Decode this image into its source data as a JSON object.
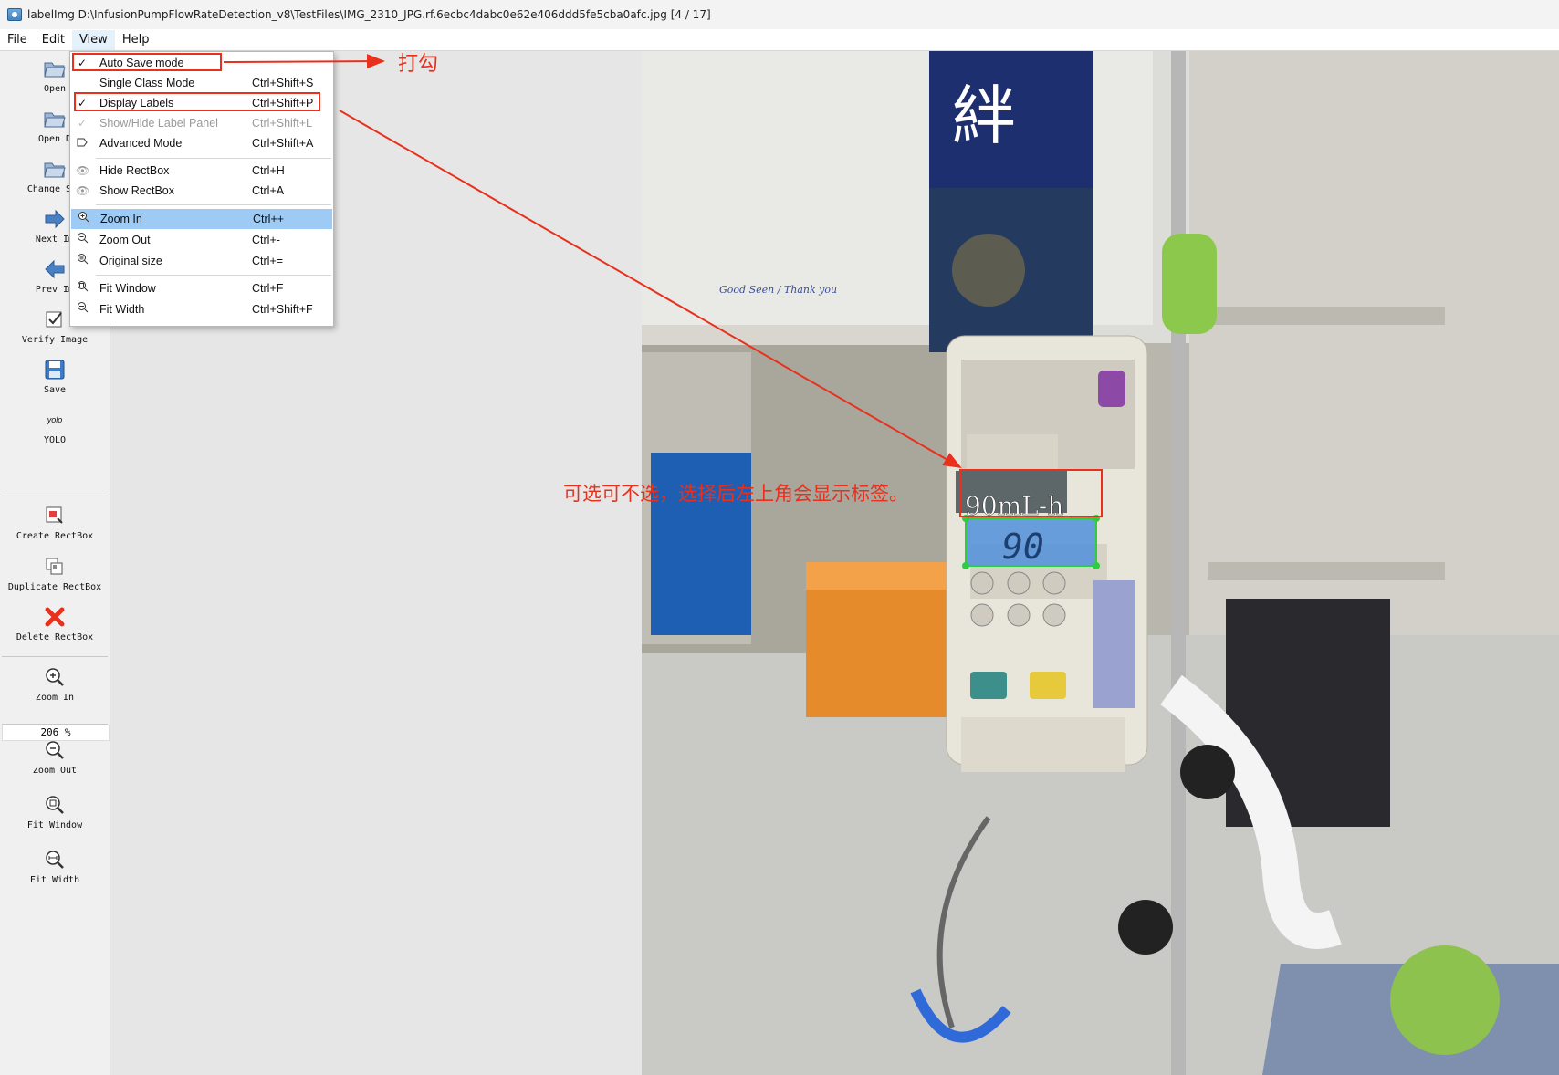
{
  "window": {
    "title": "labelImg D:\\InfusionPumpFlowRateDetection_v8\\TestFiles\\IMG_2310_JPG.rf.6ecbc4dabc0e62e406ddd5fe5cba0afc.jpg [4 / 17]"
  },
  "menubar": [
    "File",
    "Edit",
    "View",
    "Help"
  ],
  "view_menu": {
    "items": [
      {
        "label": "Auto Save mode",
        "shortcut": "",
        "checked": true,
        "icon": "check-icon"
      },
      {
        "label": "Single Class Mode",
        "shortcut": "Ctrl+Shift+S",
        "checked": false,
        "icon": ""
      },
      {
        "label": "Display Labels",
        "shortcut": "Ctrl+Shift+P",
        "checked": true,
        "icon": "check-icon"
      },
      {
        "label": "Show/Hide Label Panel",
        "shortcut": "Ctrl+Shift+L",
        "checked": true,
        "disabled": true,
        "icon": "check-icon"
      },
      {
        "label": "Advanced Mode",
        "shortcut": "Ctrl+Shift+A",
        "icon": "label-icon"
      },
      {
        "label": "Hide RectBox",
        "shortcut": "Ctrl+H",
        "icon": "eye-icon"
      },
      {
        "label": "Show RectBox",
        "shortcut": "Ctrl+A",
        "icon": "eye-icon"
      },
      {
        "label": "Zoom In",
        "shortcut": "Ctrl++",
        "icon": "zoom-in-icon",
        "highlighted": true
      },
      {
        "label": "Zoom Out",
        "shortcut": "Ctrl+-",
        "icon": "zoom-out-icon"
      },
      {
        "label": "Original size",
        "shortcut": "Ctrl+=",
        "icon": "zoom-original-icon"
      },
      {
        "label": "Fit Window",
        "shortcut": "Ctrl+F",
        "icon": "fit-window-icon"
      },
      {
        "label": "Fit Width",
        "shortcut": "Ctrl+Shift+F",
        "icon": "fit-width-icon"
      }
    ]
  },
  "toolbar": {
    "tools": [
      {
        "label": "Open",
        "icon": "folder-icon"
      },
      {
        "label": "Open D",
        "icon": "folder-icon"
      },
      {
        "label": "Change Sav",
        "icon": "folder-icon"
      },
      {
        "label": "Next Im",
        "icon": "arrow-right-icon"
      },
      {
        "label": "Prev Im",
        "icon": "arrow-left-icon"
      },
      {
        "label": "Verify Image",
        "icon": "checkbox-icon"
      },
      {
        "label": "Save",
        "icon": "floppy-icon"
      },
      {
        "label": "YOLO",
        "icon": "yolo-icon",
        "icon_text": "yolo"
      },
      {
        "label": "Create RectBox",
        "icon": "create-rect-icon"
      },
      {
        "label": "Duplicate RectBox",
        "icon": "duplicate-icon"
      },
      {
        "label": "Delete RectBox",
        "icon": "delete-icon"
      },
      {
        "label": "Zoom In",
        "icon": "zoom-in-icon"
      },
      {
        "label": "Zoom Out",
        "icon": "zoom-out-icon"
      },
      {
        "label": "Fit Window",
        "icon": "fit-window-icon"
      },
      {
        "label": "Fit Width",
        "icon": "fit-width-icon"
      }
    ],
    "zoom_value": "206 %"
  },
  "annotations": {
    "check_note": "打勾",
    "optional_note": "可选可不选，选择后左上角会显示标签。"
  },
  "image": {
    "box_label": "90mL-h",
    "display_value": "90",
    "handwriting": "Good Seen / Thank you",
    "poster_char": "絆"
  },
  "colors": {
    "annotation_red": "#e8301c",
    "menu_highlight": "#9ecbf5",
    "bbox_fill": "#4f90d9",
    "handle_green": "#2ecc40"
  }
}
